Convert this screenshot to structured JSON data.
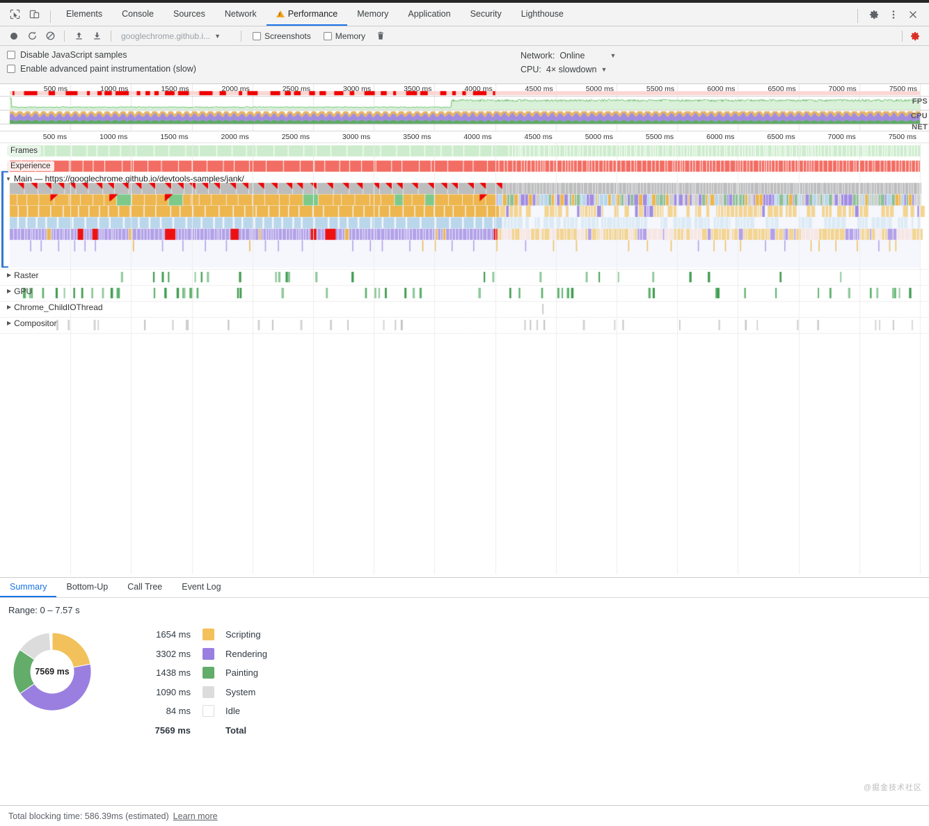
{
  "window": {
    "tabs": [
      {
        "label": "Elements",
        "active": false,
        "warn": false
      },
      {
        "label": "Console",
        "active": false,
        "warn": false
      },
      {
        "label": "Sources",
        "active": false,
        "warn": false
      },
      {
        "label": "Network",
        "active": false,
        "warn": false
      },
      {
        "label": "Performance",
        "active": true,
        "warn": true
      },
      {
        "label": "Memory",
        "active": false,
        "warn": false
      },
      {
        "label": "Application",
        "active": false,
        "warn": false
      },
      {
        "label": "Security",
        "active": false,
        "warn": false
      },
      {
        "label": "Lighthouse",
        "active": false,
        "warn": false
      }
    ],
    "left_icons": [
      "inspect-element-icon",
      "device-toolbar-icon"
    ],
    "right_icons": [
      "gear-icon",
      "more-vertical-icon",
      "close-icon"
    ]
  },
  "record_toolbar": {
    "record_label": "record-icon",
    "reload_label": "reload-and-record-icon",
    "clear_label": "clear-icon",
    "load_label": "load-profile-icon",
    "save_label": "save-profile-icon",
    "url": "googlechrome.github.i...",
    "screenshots": {
      "label": "Screenshots",
      "checked": false
    },
    "memory": {
      "label": "Memory",
      "checked": false
    },
    "trash_label": "delete-icon",
    "settings_label": "capture-settings-icon"
  },
  "capture_settings": {
    "disable_js_samples": {
      "label": "Disable JavaScript samples",
      "checked": false
    },
    "advanced_paint": {
      "label": "Enable advanced paint instrumentation (slow)",
      "checked": false
    },
    "network": {
      "label": "Network:",
      "value": "Online"
    },
    "cpu": {
      "label": "CPU:",
      "value": "4× slowdown"
    }
  },
  "overview": {
    "ticks": [
      "500 ms",
      "1000 ms",
      "1500 ms",
      "2000 ms",
      "2500 ms",
      "3000 ms",
      "3500 ms",
      "4000 ms",
      "4500 ms",
      "5000 ms",
      "5500 ms",
      "6000 ms",
      "6500 ms",
      "7000 ms",
      "7500 ms"
    ],
    "bands": [
      "FPS",
      "CPU",
      "NET"
    ]
  },
  "timeline": {
    "ticks": [
      "500 ms",
      "1000 ms",
      "1500 ms",
      "2000 ms",
      "2500 ms",
      "3000 ms",
      "3500 ms",
      "4000 ms",
      "4500 ms",
      "5000 ms",
      "5500 ms",
      "6000 ms",
      "6500 ms",
      "7000 ms",
      "7500 ms"
    ],
    "tracks": [
      {
        "name": "Frames",
        "style": "pill-green",
        "expandable": false
      },
      {
        "name": "Experience",
        "style": "pill-red",
        "expandable": false
      },
      {
        "name": "Main — https://googlechrome.github.io/devtools-samples/jank/",
        "style": "main",
        "expanded": true
      },
      {
        "name": "Raster",
        "style": "plain",
        "expandable": true
      },
      {
        "name": "GPU",
        "style": "plain",
        "expandable": true
      },
      {
        "name": "Chrome_ChildIOThread",
        "style": "plain",
        "expandable": true
      },
      {
        "name": "Compositor",
        "style": "plain",
        "expandable": true
      }
    ]
  },
  "drawer": {
    "tabs": [
      {
        "label": "Summary",
        "active": true
      },
      {
        "label": "Bottom-Up",
        "active": false
      },
      {
        "label": "Call Tree",
        "active": false
      },
      {
        "label": "Event Log",
        "active": false
      }
    ],
    "range": "Range: 0 – 7.57 s",
    "donut_center": "7569 ms"
  },
  "chart_data": {
    "type": "pie",
    "title": "Activity breakdown",
    "center_label": "7569 ms",
    "unit": "ms",
    "categories": [
      "Scripting",
      "Rendering",
      "Painting",
      "System",
      "Idle"
    ],
    "values": [
      1654,
      3302,
      1438,
      1090,
      84
    ],
    "labels": [
      "1654 ms",
      "3302 ms",
      "1438 ms",
      "1090 ms",
      "84 ms"
    ],
    "colors": [
      "#f2c15b",
      "#9a7fe0",
      "#63ac6a",
      "#dcdcdc",
      "#ffffff"
    ],
    "total": 7569,
    "total_label": "7569 ms",
    "total_name": "Total",
    "legend_position": "right",
    "grid": false
  },
  "status": {
    "blocking_time": "Total blocking time: 586.39ms (estimated)",
    "learn_more": "Learn more",
    "watermark": "@掘金技术社区"
  },
  "colors": {
    "accent": "#1a73e8",
    "scripting": "#f2c15b",
    "rendering": "#9a7fe0",
    "painting": "#63ac6a",
    "system": "#dcdcdc",
    "idle": "#ffffff",
    "frames_green": "#cdeccd",
    "experience_red": "#f26d63",
    "warning": "#f5a623",
    "record_red": "#d93025"
  }
}
